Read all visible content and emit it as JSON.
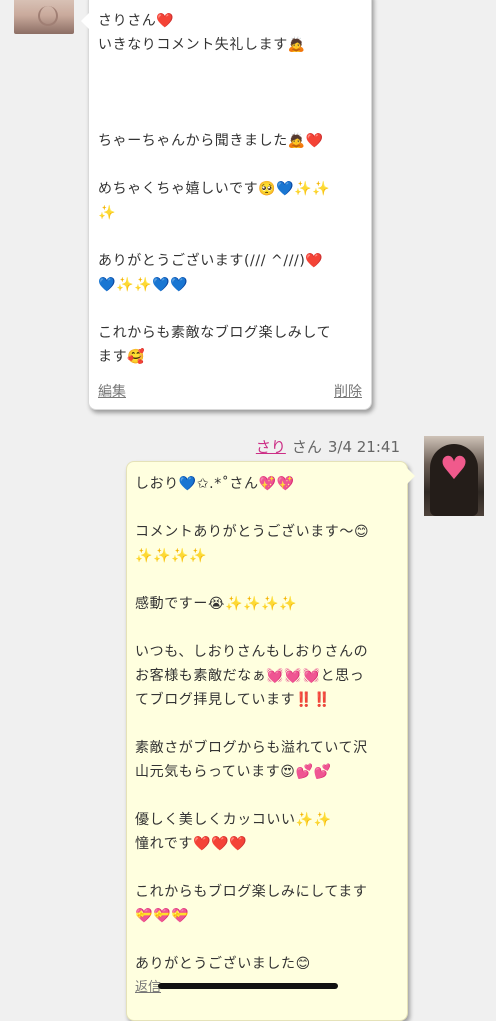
{
  "first_comment": {
    "message": "さりさん❤️\nいきなりコメント失礼します🙇\n\n\n\nちゃーちゃんから聞きました🙇❤️\n\nめちゃくちゃ嬉しいです🥺💙✨✨\n✨\n\nありがとうございます(/// ^///)❤️\n💙✨✨💙💙\n\nこれからも素敵なブログ楽しみして\nます🥰",
    "edit_label": "編集",
    "delete_label": "削除"
  },
  "reply": {
    "author": "さり",
    "honorific": "さん",
    "datetime": "3/4 21:41",
    "message": "しおり💙✩.*˚さん💖💖\n\nコメントありがとうございます〜😊\n✨✨✨✨\n\n感動ですー😭✨✨✨✨\n\nいつも、しおりさんもしおりさんの\nお客様も素敵だなぁ💓💓💓と思っ\nてブログ拝見しています‼️‼️\n\n素敵さがブログからも溢れていて沢\n山元気もらっています😍💕💕\n\n優しく美しくカッコいい✨✨\n憧れです❤️❤️❤️\n\nこれからもブログ楽しみにしてます\n💝💝💝\n\nありがとうございました😊",
    "reply_label": "返信"
  }
}
